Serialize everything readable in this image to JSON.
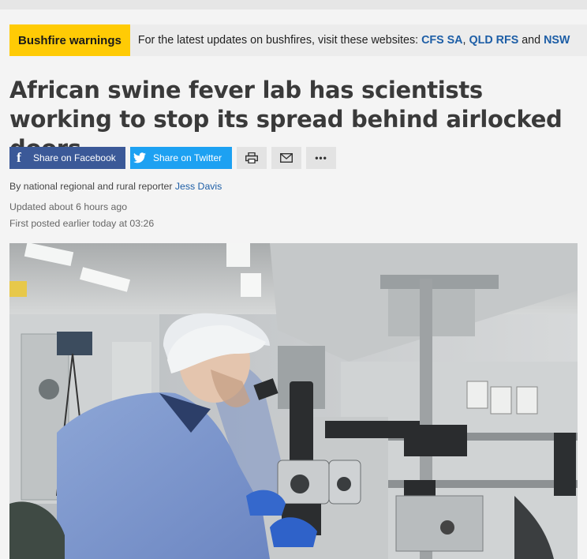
{
  "banner": {
    "label": "Bushfire warnings",
    "text": "For the latest updates on bushfires, visit these websites:",
    "links": [
      "CFS SA",
      "QLD RFS",
      "NSW"
    ],
    "sep1": ",",
    "sep2": "and"
  },
  "article": {
    "headline": "African swine fever lab has scientists working to stop its spread behind airlocked doors",
    "byline_prefix": "By national regional and rural reporter",
    "author": "Jess Davis",
    "updated": "Updated about 6 hours ago",
    "posted": "First posted earlier today at 03:26"
  },
  "share": {
    "facebook_label": "Share on Facebook",
    "twitter_label": "Share on Twitter",
    "facebook_icon": "facebook-icon",
    "twitter_icon": "twitter-icon",
    "print_icon": "print-icon",
    "mail_icon": "mail-icon",
    "more_icon": "more-icon"
  },
  "colors": {
    "banner_accent": "#ffcb05",
    "link": "#1d5ea6",
    "facebook": "#3b5998",
    "twitter": "#1da1f2"
  }
}
